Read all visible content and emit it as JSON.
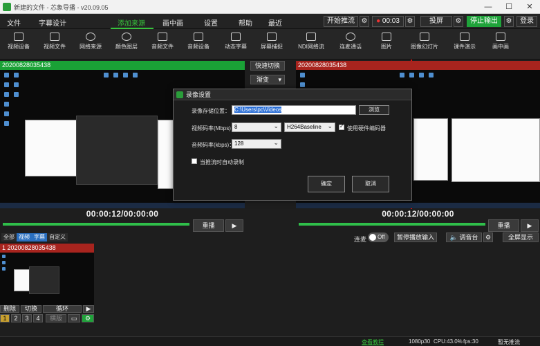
{
  "window": {
    "title": "新建的文件 - 芯象导播 - v20.09.05",
    "min": "—",
    "max": "☐",
    "close": "✕"
  },
  "menu": {
    "items": [
      "文件",
      "字幕设计",
      "添加来源",
      "画中画",
      "设置",
      "帮助",
      "最近"
    ],
    "start_stream": "开始推流",
    "rec_time": "00:03",
    "project": "投屏",
    "stop_output": "停止输出",
    "login": "登录"
  },
  "toolbar": [
    "视频设备",
    "视频文件",
    "网络来源",
    "颜色图层",
    "音频文件",
    "音频设备",
    "动态字幕",
    "屏幕捕捉",
    "NDI网络流",
    "连麦通话",
    "图片",
    "图像幻灯片",
    "课件演示",
    "画中画"
  ],
  "preview": {
    "label": "20200828035438",
    "time": "00:00:12/00:00:00",
    "replay": "重播"
  },
  "program": {
    "label": "20200828035438",
    "time": "00:00:12/00:00:00",
    "replay": "重播"
  },
  "center": {
    "quick_switch": "快速切换",
    "transition": "渐变"
  },
  "dialog": {
    "title": "录像设置",
    "path_label": "录像存储位置：",
    "path_value": "C:\\Users\\pc\\Videos",
    "browse": "浏览",
    "video_bitrate_label": "视频码率(Mbps)：",
    "video_bitrate": "8",
    "codec": "H264Baseline",
    "hw_encoder": "使用硬件编码器",
    "audio_bitrate_label": "音频码率(kbps)：",
    "audio_bitrate": "128",
    "auto_record": "当推流时自动录制",
    "ok": "确定",
    "cancel": "取消"
  },
  "bottom": {
    "tabs": [
      "全部",
      "视频",
      "字幕",
      "自定义"
    ],
    "lianmai": "连麦",
    "toggle": "Off",
    "pause_input": "暂停播放输入",
    "mixer": "调音台",
    "fullscreen": "全屏显示",
    "source_label": "1 20200828035438",
    "src_buttons": [
      "删除",
      "切换",
      "循环"
    ],
    "pages": [
      "1",
      "2",
      "3",
      "4"
    ],
    "layout_btn": "横版"
  },
  "status": {
    "link": "查看教程",
    "res": "1080p30",
    "cpu": "CPU:43.0%",
    "fps": "fps:30",
    "stream": "暂无推流"
  }
}
